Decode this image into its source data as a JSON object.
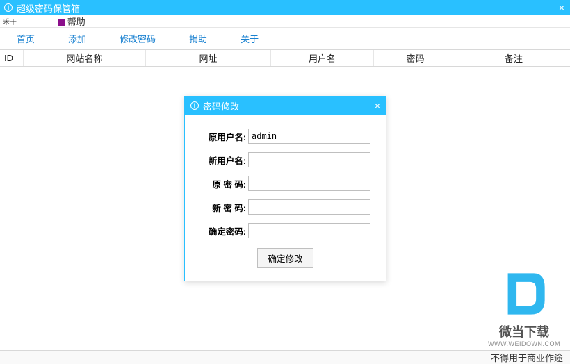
{
  "window": {
    "title": "超级密码保管箱",
    "close_icon": "×"
  },
  "toolbar": {
    "item1": "禾干",
    "item2": "帮助"
  },
  "menu": {
    "home": "首页",
    "add": "添加",
    "change_pwd": "修改密码",
    "donate": "捐助",
    "about": "关于"
  },
  "columns": {
    "id": "ID",
    "name": "网站名称",
    "url": "网址",
    "user": "用户名",
    "pwd": "密码",
    "note": "备注"
  },
  "modal": {
    "title": "密码修改",
    "close_icon": "×",
    "labels": {
      "old_user": "原用户名:",
      "new_user": "新用户名:",
      "old_pwd": "原 密 码:",
      "new_pwd": "新 密 码:",
      "confirm_pwd": "确定密码:"
    },
    "values": {
      "old_user": "admin",
      "new_user": "",
      "old_pwd": "",
      "new_pwd": "",
      "confirm_pwd": ""
    },
    "submit": "确定修改"
  },
  "status": {
    "text": "不得用于商业作途"
  },
  "watermark": {
    "text": "微当下载",
    "url": "WWW.WEIDOWN.COM"
  }
}
